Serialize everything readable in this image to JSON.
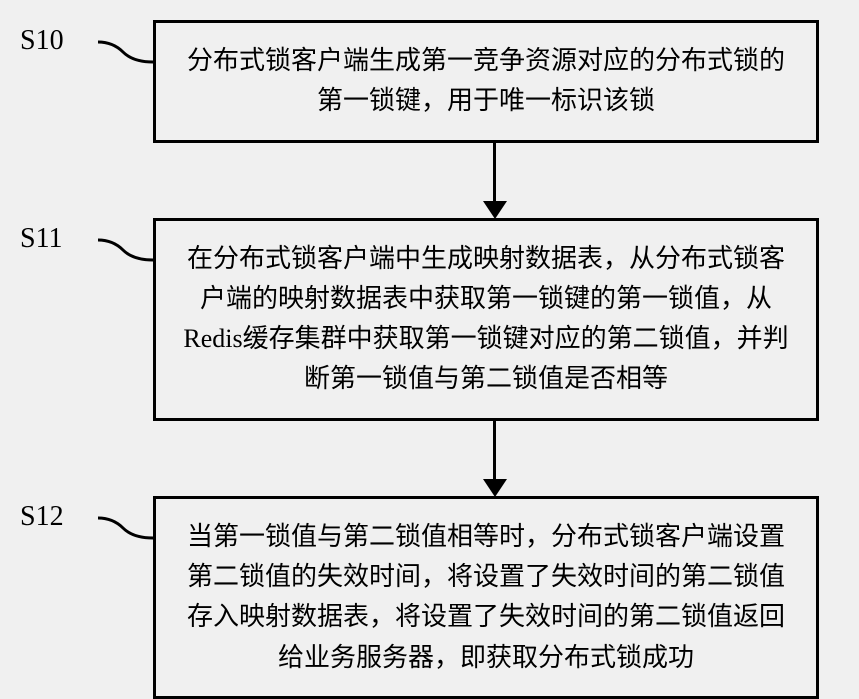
{
  "chart_data": {
    "type": "flowchart",
    "title": "",
    "steps": [
      {
        "id": "S10",
        "text": "分布式锁客户端生成第一竞争资源对应的分布式锁的第一锁键，用于唯一标识该锁"
      },
      {
        "id": "S11",
        "text": "在分布式锁客户端中生成映射数据表，从分布式锁客户端的映射数据表中获取第一锁键的第一锁值，从Redis缓存集群中获取第一锁键对应的第二锁值，并判断第一锁值与第二锁值是否相等"
      },
      {
        "id": "S12",
        "text": "当第一锁值与第二锁值相等时，分布式锁客户端设置第二锁值的失效时间，将设置了失效时间的第二锁值存入映射数据表，将设置了失效时间的第二锁值返回给业务服务器，即获取分布式锁成功"
      }
    ]
  }
}
